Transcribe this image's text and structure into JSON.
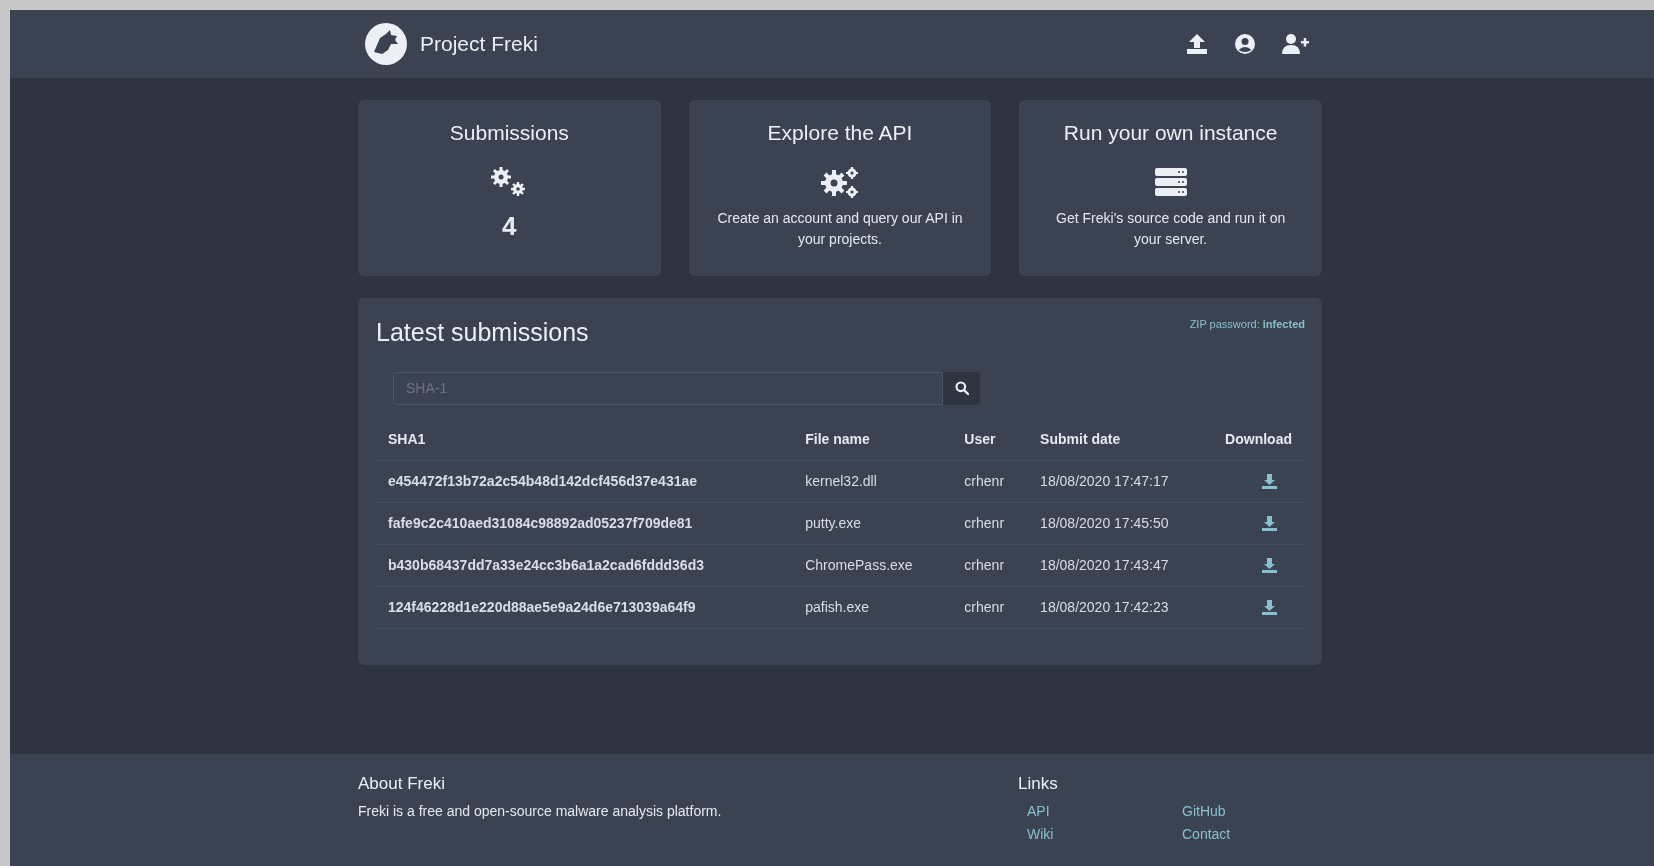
{
  "header": {
    "brand": "Project Freki"
  },
  "cards": [
    {
      "kind": "count",
      "title": "Submissions",
      "value": "4"
    },
    {
      "kind": "api",
      "title": "Explore the API",
      "text": "Create an account and query our API in your projects."
    },
    {
      "kind": "server",
      "title": "Run your own instance",
      "text": "Get Freki's source code and run it on your server."
    }
  ],
  "latest": {
    "title": "Latest submissions",
    "zip_label": "ZIP password:",
    "zip_password": "infected",
    "search": {
      "placeholder": "SHA-1"
    },
    "columns": [
      "SHA1",
      "File name",
      "User",
      "Submit date",
      "Download"
    ],
    "rows": [
      {
        "sha1": "e454472f13b72a2c54b48d142dcf456d37e431ae",
        "file": "kernel32.dll",
        "user": "crhenr",
        "date": "18/08/2020 17:47:17"
      },
      {
        "sha1": "fafe9c2c410aed31084c98892ad05237f709de81",
        "file": "putty.exe",
        "user": "crhenr",
        "date": "18/08/2020 17:45:50"
      },
      {
        "sha1": "b430b68437dd7a33e24cc3b6a1a2cad6fddd36d3",
        "file": "ChromePass.exe",
        "user": "crhenr",
        "date": "18/08/2020 17:43:47"
      },
      {
        "sha1": "124f46228d1e220d88ae5e9a24d6e713039a64f9",
        "file": "pafish.exe",
        "user": "crhenr",
        "date": "18/08/2020 17:42:23"
      }
    ]
  },
  "footer": {
    "about_title": "About Freki",
    "about_text": "Freki is a free and open-source malware analysis platform.",
    "links_title": "Links",
    "links": [
      "API",
      "GitHub",
      "Wiki",
      "Contact"
    ]
  }
}
